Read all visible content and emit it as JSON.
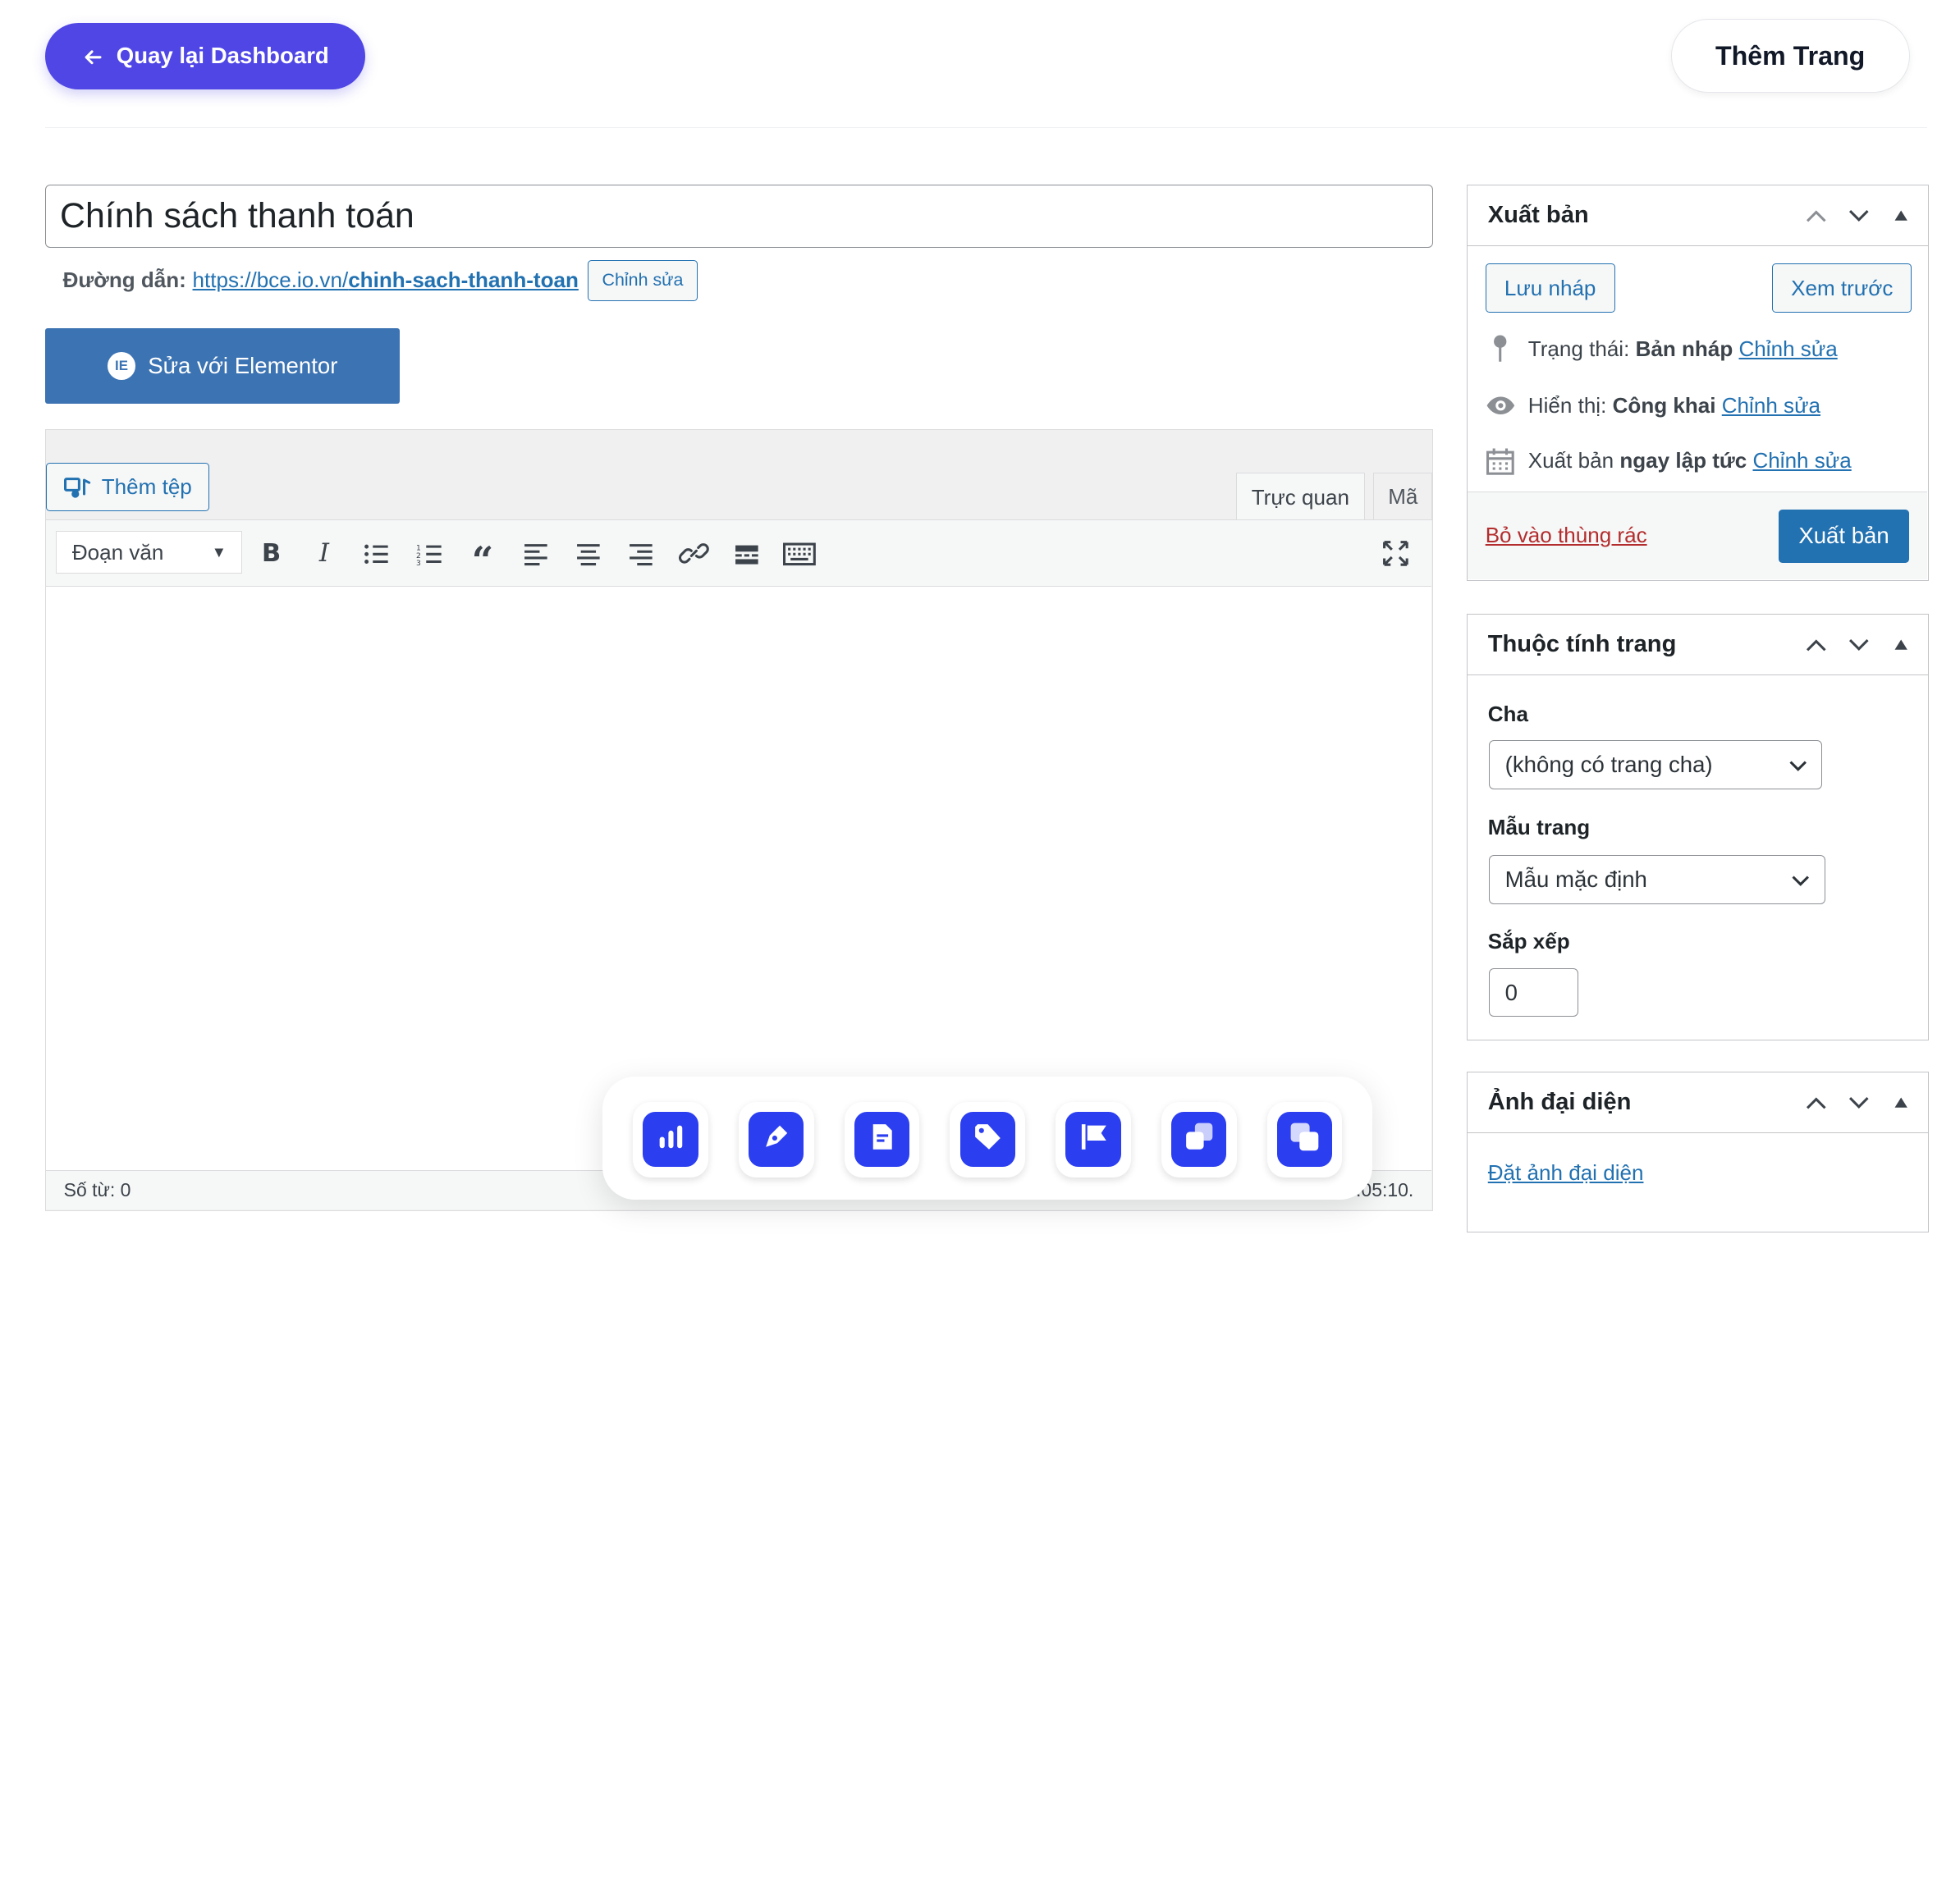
{
  "header": {
    "back_label": "Quay lại Dashboard",
    "add_page_label": "Thêm Trang"
  },
  "post": {
    "title": "Chính sách thanh toán",
    "permalink_label": "Đường dẫn:",
    "permalink_base": "https://bce.io.vn/",
    "permalink_slug": "chinh-sach-thanh-toan",
    "permalink_edit": "Chỉnh sửa",
    "elementor_label": "Sửa với Elementor",
    "elementor_icon_text": "IE"
  },
  "editor": {
    "add_media": "Thêm tệp",
    "tab_visual": "Trực quan",
    "tab_code": "Mã",
    "format_value": "Đoạn văn",
    "word_count": "Số từ: 0",
    "last_edited": ":05:10."
  },
  "publish_box": {
    "title": "Xuất bản",
    "save_draft": "Lưu nháp",
    "preview": "Xem trước",
    "status_label": "Trạng thái:",
    "status_value": "Bản nháp",
    "visibility_label": "Hiển thị:",
    "visibility_value": "Công khai",
    "schedule_label": "Xuất bản",
    "schedule_value": "ngay lập tức",
    "edit_link": "Chỉnh sửa",
    "trash": "Bỏ vào thùng rác",
    "publish": "Xuất bản"
  },
  "attributes_box": {
    "title": "Thuộc tính trang",
    "parent_label": "Cha",
    "parent_value": "(không có trang cha)",
    "template_label": "Mẫu trang",
    "template_value": "Mẫu mặc định",
    "order_label": "Sắp xếp",
    "order_value": "0"
  },
  "featured_box": {
    "title": "Ảnh đại diện",
    "set_link": "Đặt ảnh đại diện"
  },
  "dock": {
    "items": [
      "chart-icon",
      "pen-icon",
      "document-icon",
      "tag-icon",
      "flag-icon",
      "copy-icon",
      "layers-icon"
    ],
    "accent": "#2c3ff0"
  },
  "colors": {
    "back_button": "#4f46e5",
    "wp_blue": "#2271b1",
    "elementor_blue": "#3c73b3",
    "trash_red": "#b32d2e"
  }
}
